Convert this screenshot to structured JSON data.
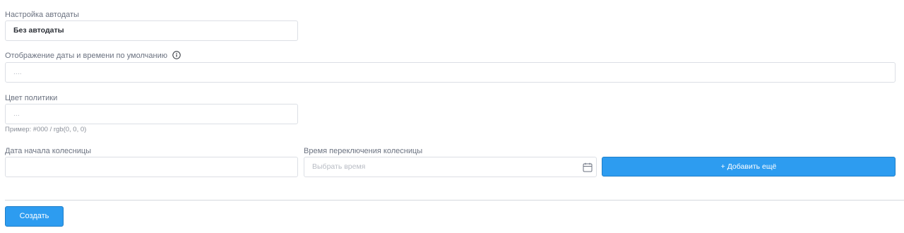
{
  "autodate": {
    "label": "Настройка автодаты",
    "value": "Без автодаты"
  },
  "datetime_display": {
    "label": "Отображение даты и времени по умолчанию",
    "icon": "info-icon",
    "placeholder": "...."
  },
  "policy_color": {
    "label": "Цвет политики",
    "placeholder": "...",
    "hint": "Пример: #000 / rgb(0, 0, 0)"
  },
  "chariot_start_date": {
    "label": "Дата начала колесницы",
    "value": ""
  },
  "chariot_switch_time": {
    "label": "Время переключения колесницы",
    "placeholder": "Выбрать время",
    "icon": "calendar-icon"
  },
  "add_more_label": "+ Добавить ещё",
  "create_label": "Создать",
  "colors": {
    "accent": "#2d9cf0",
    "border": "#dcdfe5",
    "label": "#6b7280"
  }
}
